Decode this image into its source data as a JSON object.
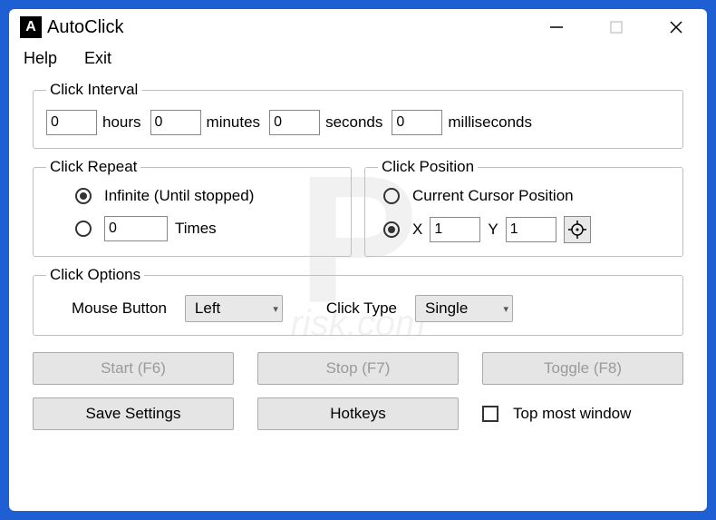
{
  "title": "AutoClick",
  "menu": {
    "help": "Help",
    "exit": "Exit"
  },
  "interval": {
    "legend": "Click Interval",
    "hours_label": "hours",
    "hours_value": "0",
    "minutes_label": "minutes",
    "minutes_value": "0",
    "seconds_label": "seconds",
    "seconds_value": "0",
    "ms_label": "milliseconds",
    "ms_value": "0"
  },
  "repeat": {
    "legend": "Click Repeat",
    "infinite_label": "Infinite (Until stopped)",
    "times_value": "0",
    "times_label": "Times"
  },
  "position": {
    "legend": "Click Position",
    "cursor_label": "Current Cursor Position",
    "x_label": "X",
    "x_value": "1",
    "y_label": "Y",
    "y_value": "1"
  },
  "options": {
    "legend": "Click Options",
    "mouse_button_label": "Mouse Button",
    "mouse_button_value": "Left",
    "click_type_label": "Click Type",
    "click_type_value": "Single"
  },
  "buttons": {
    "start": "Start (F6)",
    "stop": "Stop (F7)",
    "toggle": "Toggle (F8)",
    "save": "Save Settings",
    "hotkeys": "Hotkeys",
    "topmost": "Top most window"
  }
}
